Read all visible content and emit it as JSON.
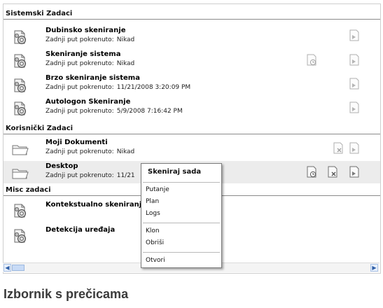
{
  "sections": [
    {
      "title": "Sistemski Zadaci"
    },
    {
      "title": "Korisnički Zadaci"
    },
    {
      "title": "Misc zadaci"
    }
  ],
  "system_tasks": [
    {
      "name": "Dubinsko skeniranje",
      "last_label": "Zadnji put pokrenuto:",
      "last_value": "Nikad"
    },
    {
      "name": "Skeniranje sistema",
      "last_label": "Zadnji put pokrenuto:",
      "last_value": "Nikad"
    },
    {
      "name": "Brzo skeniranje sistema",
      "last_label": "Zadnji put pokrenuto:",
      "last_value": "11/21/2008 3:20:09 PM"
    },
    {
      "name": "Autologon Skeniranje",
      "last_label": "Zadnji put pokrenuto:",
      "last_value": "5/9/2008 7:16:42 PM"
    }
  ],
  "user_tasks": [
    {
      "name": "Moji Dokumenti",
      "last_label": "Zadnji put pokrenuto:",
      "last_value": "Nikad"
    },
    {
      "name": "Desktop",
      "last_label": "Zadnji put pokrenuto:",
      "last_value": "11/21"
    }
  ],
  "misc_tasks": [
    {
      "name": "Kontekstualno skeniranje"
    },
    {
      "name": "Detekcija uređaja"
    }
  ],
  "context_menu": {
    "items": [
      "Skeniraj sada",
      "Putanje",
      "Plan",
      "Logs",
      "Klon",
      "Obriši",
      "Otvori"
    ]
  },
  "caption": "Izbornik s prečicama",
  "icons": {
    "task": "gear-document-icon",
    "folder": "folder-icon",
    "schedule": "schedule-clock-icon",
    "delete": "delete-task-icon",
    "run": "run-task-icon"
  },
  "colors": {
    "selected_row": "#ececec",
    "section_rule": "#8a8a8a",
    "caption": "#3a3a3a",
    "scroll_arrow": "#2f5fa8"
  }
}
